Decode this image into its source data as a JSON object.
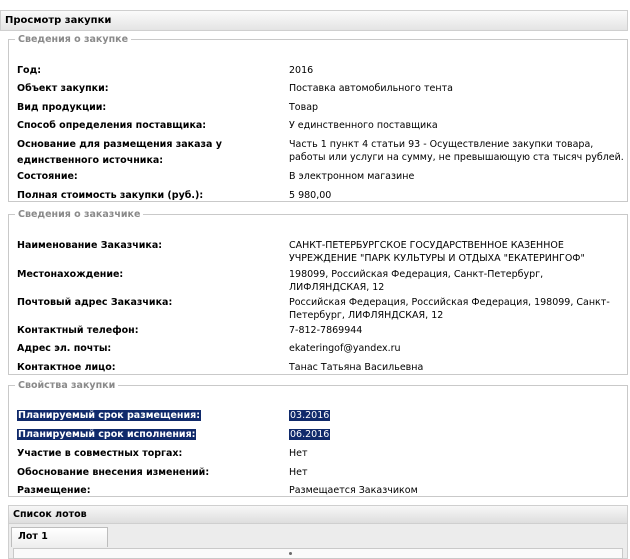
{
  "window": {
    "title": "Просмотр закупки"
  },
  "purchase_info": {
    "legend": "Сведения о закупке",
    "rows": [
      {
        "label": "Год:",
        "value": "2016"
      },
      {
        "label": "Объект закупки:",
        "value": "Поставка автомобильного тента"
      },
      {
        "label": "Вид продукции:",
        "value": "Товар"
      },
      {
        "label": "Способ определения поставщика:",
        "value": "У единственного поставщика"
      },
      {
        "label": "Основание для размещения заказа у единственного источника:",
        "value": "Часть 1 пункт 4 статьи 93 - Осуществление закупки товара, работы или услуги на сумму, не превышающую ста тысяч рублей."
      },
      {
        "label": "Состояние:",
        "value": "В электронном магазине"
      },
      {
        "label": "Полная стоимость закупки (руб.):",
        "value": "5 980,00"
      }
    ]
  },
  "customer_info": {
    "legend": "Сведения о заказчике",
    "rows": [
      {
        "label": "Наименование Заказчика:",
        "value": "САНКТ-ПЕТЕРБУРГСКОЕ ГОСУДАРСТВЕННОЕ КАЗЕННОЕ УЧРЕЖДЕНИЕ \"ПАРК КУЛЬТУРЫ И ОТДЫХА \"ЕКАТЕРИНГОФ\""
      },
      {
        "label": "Местонахождение:",
        "value": "198099, Российская Федерация, Санкт-Петербург, ЛИФЛЯНДСКАЯ, 12"
      },
      {
        "label": "Почтовый адрес Заказчика:",
        "value": "Российская Федерация, Российская Федерация, 198099, Санкт-Петербург, ЛИФЛЯНДСКАЯ, 12"
      },
      {
        "label": "Контактный телефон:",
        "value": "7-812-7869944"
      },
      {
        "label": "Адрес эл. почты:",
        "value": "ekateringof@yandex.ru"
      },
      {
        "label": "Контактное лицо:",
        "value": "Танас Татьяна Васильевна"
      }
    ]
  },
  "purchase_props": {
    "legend": "Свойства закупки",
    "rows": [
      {
        "label": "Планируемый срок размещения:",
        "value": "03.2016",
        "selected": true
      },
      {
        "label": "Планируемый срок исполнения:",
        "value": "06.2016",
        "selected": true
      },
      {
        "label": "Участие в совместных торгах:",
        "value": "Нет"
      },
      {
        "label": "Обоснование внесения изменений:",
        "value": "Нет"
      },
      {
        "label": "Размещение:",
        "value": "Размещается Заказчиком"
      }
    ]
  },
  "lots": {
    "header": "Список лотов",
    "tabs": [
      {
        "label": "Лот 1"
      }
    ]
  }
}
